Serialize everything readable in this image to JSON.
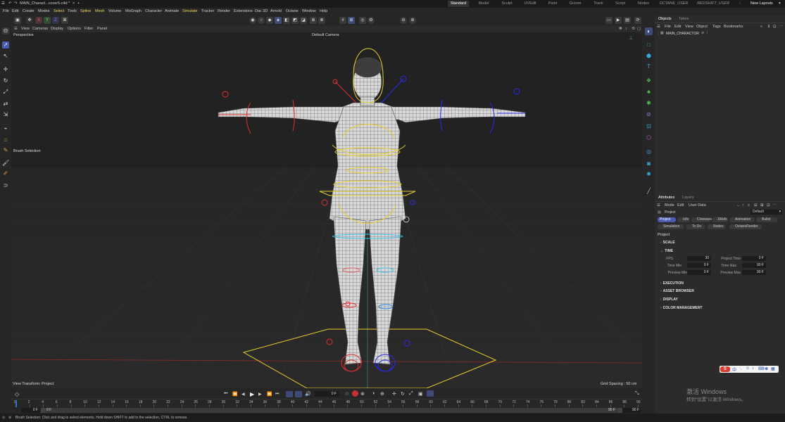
{
  "titlebar": {
    "doc_tab": "MAIN_Charact...cover5.c4d *",
    "add_tab": "+",
    "layouts": [
      "Standard",
      "Model",
      "Sculpt",
      "UVEdit",
      "Paint",
      "Groom",
      "Track",
      "Script",
      "Nodes"
    ],
    "user_layouts": [
      "OCTANE_USER",
      "REDSHIFT_USER"
    ],
    "new_layouts": "New Layouts",
    "active_layout": "Standard"
  },
  "menubar": [
    "File",
    "Edit",
    "Create",
    "Modes",
    "Select",
    "Tools",
    "Spline",
    "Mesh",
    "Volume",
    "MoGraph",
    "Character",
    "Animate",
    "Simulate",
    "Tracker",
    "Render",
    "Extensions",
    "Dac 3D",
    "Arnold",
    "Octane",
    "Window",
    "Help"
  ],
  "toolbar": {
    "coords": [
      "X",
      "Y",
      "Z"
    ]
  },
  "viewport": {
    "menu": [
      "View",
      "Cameras",
      "Display",
      "Options",
      "Filter",
      "Panel"
    ],
    "projection": "Perspective",
    "camera": "Default Camera",
    "brush_label": "Brush Selection",
    "view_transform": "View Transform: Project",
    "grid_spacing": "Grid Spacing : 50 cm"
  },
  "objects_panel": {
    "tabs": [
      "Objects",
      "Takes"
    ],
    "menu": [
      "File",
      "Edit",
      "View",
      "Object",
      "Tags",
      "Bookmarks"
    ],
    "items": [
      {
        "name": "MAIN_CHARACTOR"
      }
    ]
  },
  "attributes_panel": {
    "tabs": [
      "Attributes",
      "Layers"
    ],
    "menu": [
      "Mode",
      "Edit",
      "User Data"
    ],
    "object_label": "Project",
    "preset": "Default",
    "chips_row1": [
      "Project",
      "Info",
      "Cineware",
      "XRefs",
      "Animation",
      "Bullet"
    ],
    "chips_row2": [
      "Simulation",
      "To Do",
      "Nodes",
      "OctaneRender"
    ],
    "heading": "Project",
    "sections": [
      "SCALE",
      "TIME",
      "EXECUTION",
      "ASSET BROWSER",
      "DISPLAY",
      "COLOR MANAGEMENT"
    ],
    "time_fields": {
      "fps_label": "FPS",
      "fps": "30",
      "project_time_label": "Project Time",
      "project_time": "0 F",
      "time_min_label": "Time Min",
      "time_min": "0 F",
      "time_max_label": "Time Max",
      "time_max": "90 F",
      "preview_min_label": "Preview Min",
      "preview_min": "0 F",
      "preview_max_label": "Preview Max",
      "preview_max": "90 F"
    }
  },
  "timeline": {
    "current_frame": "0 F",
    "ticks": [
      "0",
      "2",
      "4",
      "6",
      "8",
      "10",
      "12",
      "14",
      "16",
      "18",
      "20",
      "22",
      "24",
      "26",
      "28",
      "30",
      "32",
      "34",
      "36",
      "38",
      "40",
      "42",
      "44",
      "46",
      "48",
      "50",
      "52",
      "54",
      "56",
      "58",
      "60",
      "62",
      "64",
      "66",
      "68",
      "70",
      "72",
      "74",
      "76",
      "78",
      "80",
      "82",
      "84",
      "86",
      "88",
      "90"
    ],
    "range_start": "0 F",
    "range_start2": "0 F",
    "range_end": "90 F",
    "range_end2": "90 F"
  },
  "statusbar": {
    "message": "Brush Selection: Click and drag to select elements. Hold down SHIFT to add to the selection, CTRL to remove."
  },
  "watermark": {
    "title": "激活 Windows",
    "subtitle": "转到“设置”以激活 Windows。"
  },
  "ime": {
    "label": "中"
  },
  "colors": {
    "accent": "#4b5cb2",
    "highlight_menu": "#f4d45c",
    "rig_red": "#e03030",
    "rig_blue": "#2a2aee",
    "rig_yellow": "#e8cf2a",
    "rig_cyan": "#35c3e8"
  }
}
